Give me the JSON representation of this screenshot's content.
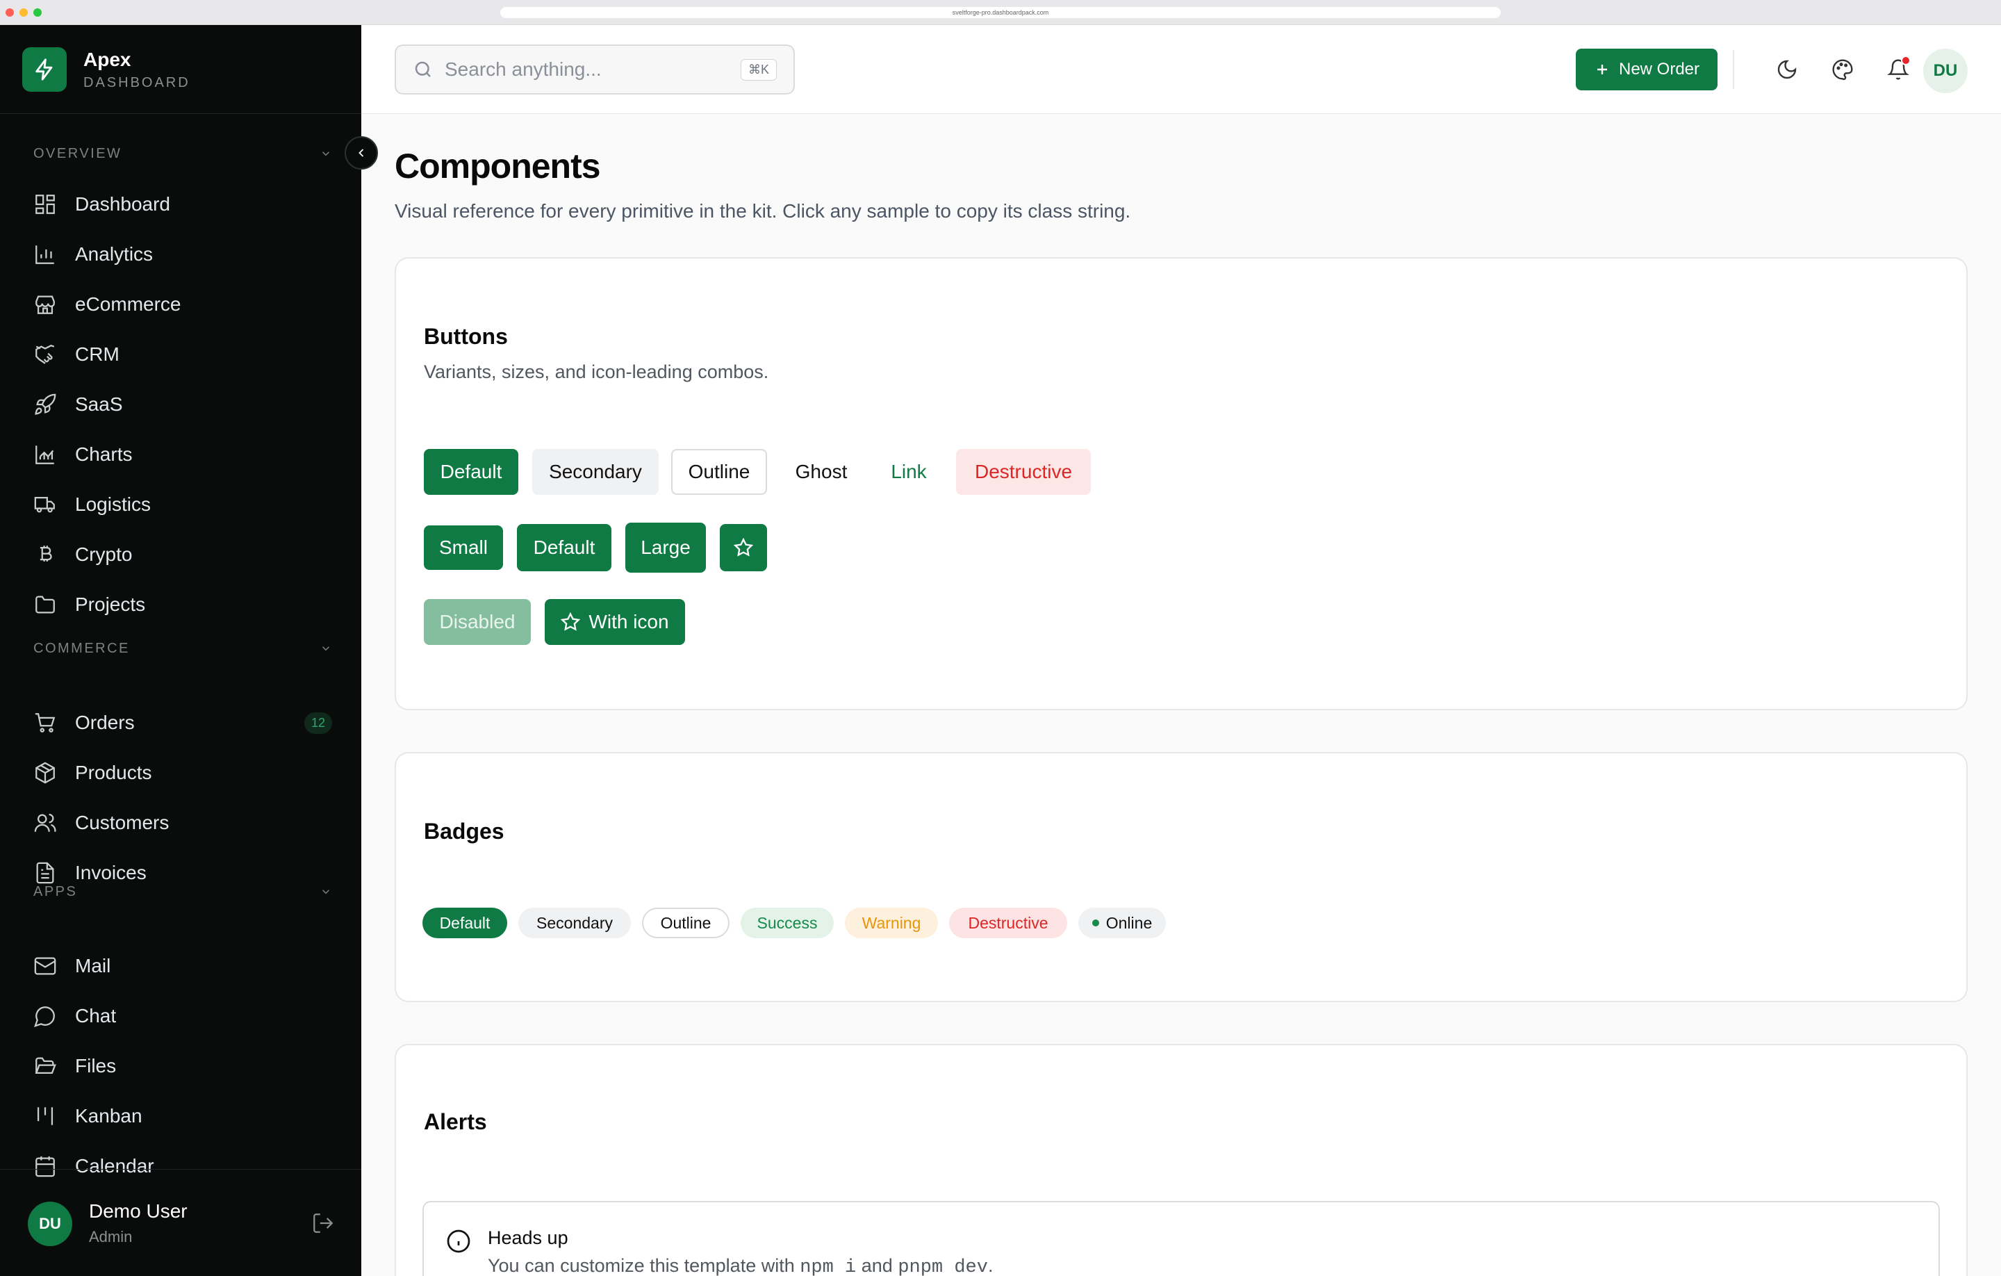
{
  "browser": {
    "url": "sveltforge-pro.dashboardpack.com"
  },
  "brand": {
    "name": "Apex",
    "subtitle": "DASHBOARD",
    "logo_icon": "bolt-icon"
  },
  "sidebar": {
    "sections": [
      {
        "label": "OVERVIEW",
        "items": [
          {
            "label": "Dashboard",
            "icon": "grid-icon"
          },
          {
            "label": "Analytics",
            "icon": "bar-chart-icon"
          },
          {
            "label": "eCommerce",
            "icon": "store-icon"
          },
          {
            "label": "CRM",
            "icon": "handshake-icon"
          },
          {
            "label": "SaaS",
            "icon": "rocket-icon"
          },
          {
            "label": "Charts",
            "icon": "area-chart-icon"
          },
          {
            "label": "Logistics",
            "icon": "truck-icon"
          },
          {
            "label": "Crypto",
            "icon": "bitcoin-icon"
          },
          {
            "label": "Projects",
            "icon": "folder-icon"
          }
        ]
      },
      {
        "label": "COMMERCE",
        "items": [
          {
            "label": "Orders",
            "icon": "cart-icon",
            "badge": "12"
          },
          {
            "label": "Products",
            "icon": "package-icon"
          },
          {
            "label": "Customers",
            "icon": "users-icon"
          },
          {
            "label": "Invoices",
            "icon": "file-text-icon"
          }
        ]
      },
      {
        "label": "APPS",
        "items": [
          {
            "label": "Mail",
            "icon": "mail-icon"
          },
          {
            "label": "Chat",
            "icon": "chat-icon"
          },
          {
            "label": "Files",
            "icon": "folder-open-icon"
          },
          {
            "label": "Kanban",
            "icon": "kanban-icon"
          },
          {
            "label": "Calendar",
            "icon": "calendar-icon"
          }
        ]
      }
    ],
    "user": {
      "initials": "DU",
      "name": "Demo User",
      "role": "Admin"
    }
  },
  "topbar": {
    "search_placeholder": "Search anything...",
    "search_shortcut": "⌘K",
    "new_order_label": "New Order",
    "avatar_initials": "DU"
  },
  "page": {
    "title": "Components",
    "subtitle": "Visual reference for every primitive in the kit. Click any sample to copy its class string."
  },
  "buttons_card": {
    "title": "Buttons",
    "description": "Variants, sizes, and icon-leading combos.",
    "variants": [
      "Default",
      "Secondary",
      "Outline",
      "Ghost",
      "Link",
      "Destructive"
    ],
    "sizes": [
      "Small",
      "Default",
      "Large"
    ],
    "disabled_label": "Disabled",
    "with_icon_label": "With icon"
  },
  "badges_card": {
    "title": "Badges",
    "badges": [
      "Default",
      "Secondary",
      "Outline",
      "Success",
      "Warning",
      "Destructive",
      "Online"
    ]
  },
  "alerts_card": {
    "title": "Alerts",
    "alert_title": "Heads up",
    "alert_text_pre": "You can customize this template with ",
    "alert_code_1": "npm i",
    "alert_text_mid": " and ",
    "alert_code_2": "pnpm dev",
    "alert_text_post": "."
  },
  "colors": {
    "accent": "#0f7a43",
    "sidebar_bg": "#0a0c0c",
    "destructive": "#dc2626",
    "warning": "#e9950c"
  }
}
